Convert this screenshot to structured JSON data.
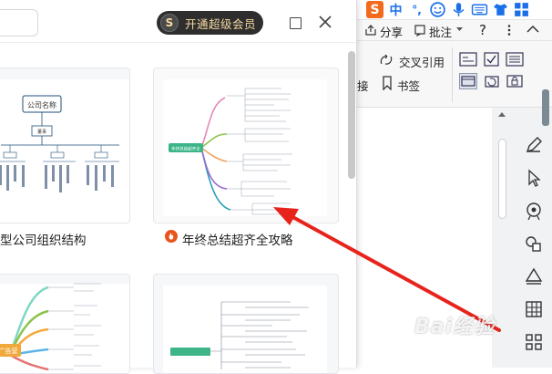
{
  "dialog": {
    "vip_button": "开通超级会员",
    "vip_logo": "S",
    "cards": [
      {
        "title": "型公司组织结构",
        "thumb_root_label": "公司名称",
        "thumb_sub_label": "董事"
      },
      {
        "title": "年终总结超齐全攻略",
        "thumb_root_label": "年终总结超齐全"
      },
      {
        "title": "",
        "thumb_root_label": "广告营"
      },
      {
        "title": "",
        "thumb_root_label": ""
      }
    ]
  },
  "ime": {
    "logo": "S",
    "mode": "中",
    "punct": "°,"
  },
  "ribbon": {
    "share_label": "分享",
    "annotate_label": "批注",
    "help_label": "?",
    "cross_ref_label": "交叉引用",
    "bookmark_label": "书签",
    "left_cut_label": "接"
  },
  "watermark": "Bai经验",
  "colors": {
    "arrow": "#e8231c",
    "vip_bg": "#2e2e2e",
    "vip_text": "#f5d9a1",
    "brand": "#e8541c"
  }
}
